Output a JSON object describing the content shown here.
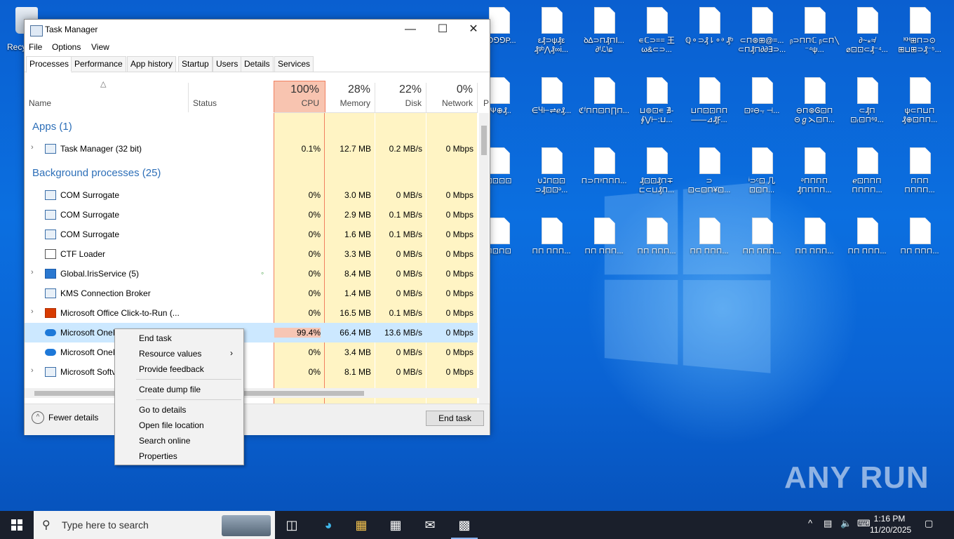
{
  "desktop": {
    "recycle_label": "Recy",
    "icons": [
      {
        "label": "⅁⅁⅁⅁P..."
      },
      {
        "label": "ε₰⊃ψ₰ε ₰ᵍᵇ⋀₰∞i..."
      },
      {
        "label": "ꝺ∆⊃⊓₰⊓ⵏ... ∂ᶠℒ\\ɕ"
      },
      {
        "label": "∊ℂ⊃== 王ω&⊂⊃..."
      },
      {
        "label": "ℚ⚬⊃₰⇂⚬ᵊ ₰ᵇ"
      },
      {
        "label": "⊂⊓⊛⊞@=... ⊂⊓₰⊓∂∂∃⊃..."
      },
      {
        "label": "ᵦ⊃⊓⊓ℂ ᵦ⊂⊓╲ ⁻⁴ψ..."
      },
      {
        "label": "∂~⁎≉ ⌀⊡⊡⊂₰⁻⁴..."
      },
      {
        "label": "ᴷᴴ⊞⊓⊃⊙ ⊞⊔⊞⊃₰⁻⁵..."
      },
      {
        "label": "∂Ψ⊕₰.."
      },
      {
        "label": "∈Ⴗ⊢⇌ℯ₰..."
      },
      {
        "label": "ℭᶠ⊓⊓⊡⊓∏⊓..."
      },
      {
        "label": "⊔⊚⊡∊ ∄-∮⋁⊢:⊔..."
      },
      {
        "label": "⊔⊓⊡⊡⊓⊓ ——⊿₰Ꝼ..."
      },
      {
        "label": "⊡ᵍ⊖-ᵣ ⊣..."
      },
      {
        "label": "⊖⊓⊛Ꮆ⊡⊓ ⊝ℊ⋋⊡⊓..."
      },
      {
        "label": "⊂₰⊓ ⊡ᵣ⊡⊓⁶ᵍ..."
      },
      {
        "label": "ψ⊂⊓⊔⊓ ₰⊕⊡⊓⊓..."
      },
      {
        "label": "⊡⊡⊡⊡"
      },
      {
        "label": "∪ℷ⊓⊡⊡ ⊃₰⊡⊡ᵊ..."
      },
      {
        "label": "⊓⊃⊓ᵞ⊓⊓⊓..."
      },
      {
        "label": "₰⊡⊡₰⊓∓ ⊏⊂⊔₰⊓..."
      },
      {
        "label": "⊃ ⊡⊂⊡⊓¥⊡..."
      },
      {
        "label": "ᶤ⊃ᶜ⊡ 几⊡⊡⊓..."
      },
      {
        "label": "ᵊ⊓⊓⊓⊓ ₰⊓⊓⊓⊓..."
      },
      {
        "label": "ℯ⊡⊓⊓⊓ ⊓⊓⊓⊓..."
      },
      {
        "label": "⊓⊓⊓ ⊓⊓⊓⊓..."
      },
      {
        "label": "⊓⊡⊓⊡"
      },
      {
        "label": "⊓⊓ ⊓⊓⊓..."
      },
      {
        "label": "⊓⊓ ⊓⊓⊓..."
      },
      {
        "label": "⊓⊓ ⊓⊓⊓..."
      },
      {
        "label": "⊓⊓ ⊓⊓⊓..."
      },
      {
        "label": "⊓⊓ ⊓⊓⊓..."
      },
      {
        "label": "⊓⊓ ⊓⊓⊓..."
      },
      {
        "label": "⊓⊓ ⊓⊓⊓..."
      },
      {
        "label": "⊓⊓ ⊓⊓⊓..."
      }
    ],
    "watermark": "ANY RUN"
  },
  "task_manager": {
    "title": "Task Manager",
    "menu": [
      "File",
      "Options",
      "View"
    ],
    "tabs": [
      "Processes",
      "Performance",
      "App history",
      "Startup",
      "Users",
      "Details",
      "Services"
    ],
    "columns": {
      "name": "Name",
      "status": "Status",
      "cpu": {
        "pct": "100%",
        "label": "CPU"
      },
      "memory": {
        "pct": "28%",
        "label": "Memory"
      },
      "disk": {
        "pct": "22%",
        "label": "Disk"
      },
      "network": {
        "pct": "0%",
        "label": "Network"
      },
      "extra": "P"
    },
    "groups": {
      "apps": "Apps (1)",
      "background": "Background processes (25)"
    },
    "rows": [
      {
        "name": "Task Manager (32 bit)",
        "cpu": "0.1%",
        "memory": "12.7 MB",
        "disk": "0.2 MB/s",
        "network": "0 Mbps"
      },
      {
        "name": "COM Surrogate",
        "cpu": "0%",
        "memory": "3.0 MB",
        "disk": "0 MB/s",
        "network": "0 Mbps"
      },
      {
        "name": "COM Surrogate",
        "cpu": "0%",
        "memory": "2.9 MB",
        "disk": "0.1 MB/s",
        "network": "0 Mbps"
      },
      {
        "name": "COM Surrogate",
        "cpu": "0%",
        "memory": "1.6 MB",
        "disk": "0.1 MB/s",
        "network": "0 Mbps"
      },
      {
        "name": "CTF Loader",
        "cpu": "0%",
        "memory": "3.3 MB",
        "disk": "0 MB/s",
        "network": "0 Mbps"
      },
      {
        "name": "Global.IrisService (5)",
        "cpu": "0%",
        "memory": "8.4 MB",
        "disk": "0 MB/s",
        "network": "0 Mbps"
      },
      {
        "name": "KMS Connection Broker",
        "cpu": "0%",
        "memory": "1.4 MB",
        "disk": "0 MB/s",
        "network": "0 Mbps"
      },
      {
        "name": "Microsoft Office Click-to-Run (...",
        "cpu": "0%",
        "memory": "16.5 MB",
        "disk": "0.1 MB/s",
        "network": "0 Mbps"
      },
      {
        "name": "Microsoft OneI",
        "cpu": "99.4%",
        "memory": "66.4 MB",
        "disk": "13.6 MB/s",
        "network": "0 Mbps"
      },
      {
        "name": "Microsoft OneI",
        "cpu": "0%",
        "memory": "3.4 MB",
        "disk": "0 MB/s",
        "network": "0 Mbps"
      },
      {
        "name": "Microsoft Softv",
        "cpu": "0%",
        "memory": "8.1 MB",
        "disk": "0 MB/s",
        "network": "0 Mbps"
      }
    ],
    "footer": {
      "fewer_details": "Fewer details",
      "end_task": "End task"
    }
  },
  "context_menu": {
    "items": [
      "End task",
      "Resource values",
      "Provide feedback",
      "Create dump file",
      "Go to details",
      "Open file location",
      "Search online",
      "Properties"
    ]
  },
  "taskbar": {
    "search_placeholder": "Type here to search",
    "time": "1:16 PM",
    "date": "11/20/2025"
  }
}
